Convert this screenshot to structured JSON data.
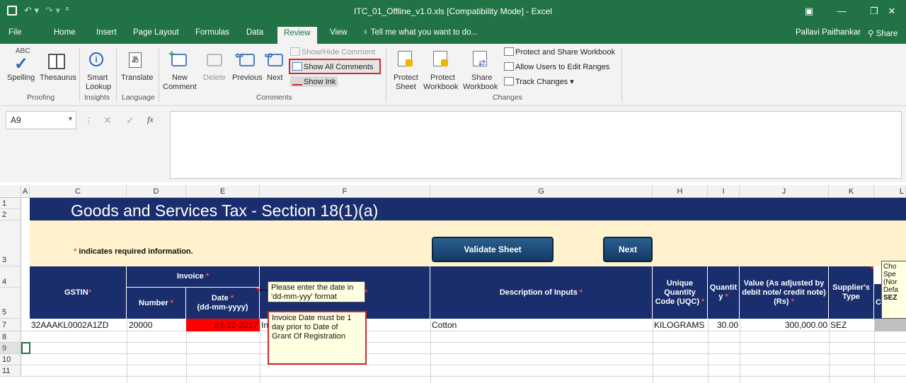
{
  "window": {
    "title": "ITC_01_Offline_v1.0.xls  [Compatibility Mode] - Excel",
    "user": "Pallavi Paithankar",
    "share": "Share"
  },
  "tabs": [
    "File",
    "Home",
    "Insert",
    "Page Layout",
    "Formulas",
    "Data",
    "Review",
    "View"
  ],
  "active_tab": "Review",
  "tell_me": "Tell me what you want to do...",
  "ribbon": {
    "proofing": {
      "spelling": "Spelling",
      "thesaurus": "Thesaurus",
      "group": "Proofing",
      "abc": "ABC"
    },
    "insights": {
      "smart_lookup_1": "Smart",
      "smart_lookup_2": "Lookup",
      "group": "Insights"
    },
    "language": {
      "translate": "Translate",
      "group": "Language"
    },
    "comments": {
      "new_1": "New",
      "new_2": "Comment",
      "delete": "Delete",
      "previous": "Previous",
      "next": "Next",
      "show_hide": "Show/Hide Comment",
      "show_all": "Show All Comments",
      "show_ink": "Show Ink",
      "group": "Comments"
    },
    "changes": {
      "protect_sheet_1": "Protect",
      "protect_sheet_2": "Sheet",
      "protect_workbook_1": "Protect",
      "protect_workbook_2": "Workbook",
      "share_workbook_1": "Share",
      "share_workbook_2": "Workbook",
      "protect_share": "Protect and Share Workbook",
      "allow_users": "Allow Users to Edit Ranges",
      "track_changes": "Track Changes",
      "group": "Changes"
    }
  },
  "formula_bar": {
    "name_box": "A9",
    "fx": "fx",
    "content": ""
  },
  "columns": [
    "A",
    "C",
    "D",
    "E",
    "F",
    "G",
    "H",
    "I",
    "J",
    "K",
    "L"
  ],
  "rows": [
    "1",
    "2",
    "3",
    "4",
    "5",
    "7",
    "8",
    "9",
    "10",
    "11"
  ],
  "sheet": {
    "title": "Goods and Services Tax - Section 18(1)(a)",
    "required_note": "indicates required information.",
    "asterisk": "*",
    "validate_btn": "Validate Sheet",
    "next_btn": "Next",
    "headers": {
      "gstin": "GSTIN",
      "invoice": "Invoice",
      "number": "Number",
      "date_1": "Date",
      "date_2": "(dd-mm-yyyy)",
      "description": "Description of Inputs",
      "uqc_1": "Unique",
      "uqc_2": "Quantity",
      "uqc_3": "Code (UQC)",
      "qty_1": "Quantit",
      "qty_2": "y",
      "value_1": "Value (As adjusted by",
      "value_2": "debit note/ credit note)",
      "value_3": "(Rs)",
      "supplier_1": "Supplier's",
      "supplier_2": "Type",
      "l_1": "Cho",
      "l_2": "Spe",
      "l_3": "(Nor",
      "l_4": "Defa",
      "l_5": "SEZ",
      "l_c": "C"
    },
    "row7": {
      "gstin": "32AAAKL0002A1ZD",
      "number": "20000",
      "date": "23-12-2017",
      "f": "In",
      "description": "Cotton",
      "uqc": "KILOGRAMS",
      "qty": "30.00",
      "value": "300,000.00",
      "supplier": "SEZ"
    }
  },
  "comments": {
    "c1_1": "Please enter the date in",
    "c1_2": "'dd-mm-yyy' format",
    "c2_1": "Invoice Date must be 1",
    "c2_2": "day prior to Date of",
    "c2_3": "Grant Of Registration"
  },
  "colors": {
    "excel_green": "#217346",
    "header_navy": "#1a2e6e",
    "highlight_red": "#d9262c",
    "date_cell_red": "#ff0000",
    "note_bg": "#fff2cc"
  }
}
